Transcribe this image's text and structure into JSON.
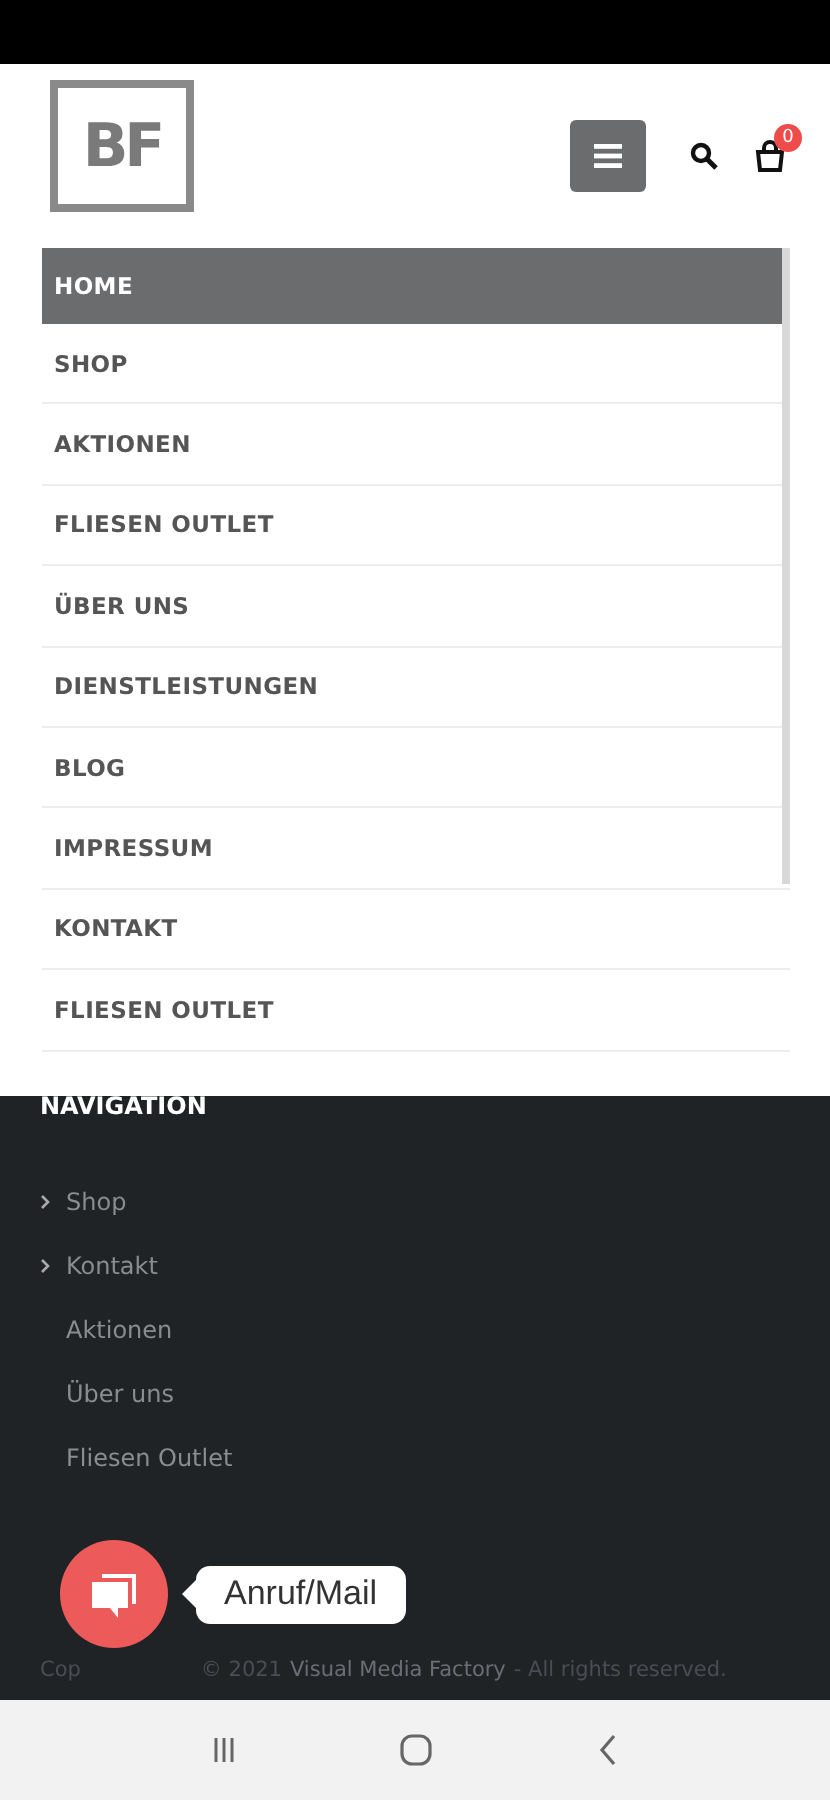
{
  "logo": {
    "text": "BF"
  },
  "header": {
    "cart_count": "0"
  },
  "menu": [
    {
      "label": "HOME",
      "selected": true
    },
    {
      "label": "SHOP",
      "selected": false
    },
    {
      "label": "AKTIONEN",
      "selected": false
    },
    {
      "label": "FLIESEN OUTLET",
      "selected": false
    },
    {
      "label": "ÜBER UNS",
      "selected": false
    },
    {
      "label": "DIENSTLEISTUNGEN",
      "selected": false
    },
    {
      "label": "BLOG",
      "selected": false
    },
    {
      "label": "IMPRESSUM",
      "selected": false
    },
    {
      "label": "KONTAKT",
      "selected": false
    },
    {
      "label": "FLIESEN OUTLET",
      "selected": false
    }
  ],
  "footer": {
    "heading": "NAVIGATION",
    "links": [
      {
        "label": "Shop",
        "kind": "arrow"
      },
      {
        "label": "Kontakt",
        "kind": "arrow"
      },
      {
        "label": "Aktionen",
        "kind": "plain"
      },
      {
        "label": "Über uns",
        "kind": "plain"
      },
      {
        "label": "Fliesen Outlet",
        "kind": "plain"
      }
    ],
    "copyright_start": "Cop",
    "copyright_year": "© 2021",
    "copyright_link": "Visual Media Factory",
    "copyright_end": "- All rights reserved."
  },
  "contact_button": {
    "label": "Anruf/Mail"
  }
}
